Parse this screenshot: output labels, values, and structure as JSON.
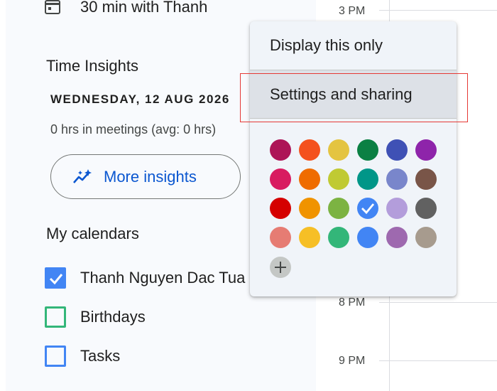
{
  "event": {
    "title": "30 min with Thanh"
  },
  "time_insights": {
    "heading": "Time Insights",
    "date": "WEDNESDAY, 12 AUG 2026",
    "meetings_summary": "0 hrs in meetings (avg: 0 hrs)",
    "more_button_label": "More insights"
  },
  "my_calendars": {
    "heading": "My calendars",
    "items": [
      {
        "label": "Thanh Nguyen Dac Tua",
        "checked": true,
        "color": "#4285f4"
      },
      {
        "label": "Birthdays",
        "checked": false,
        "color": "#33b679"
      },
      {
        "label": "Tasks",
        "checked": false,
        "color": "#4285f4"
      }
    ]
  },
  "time_grid": {
    "labels": [
      "3 PM",
      "8 PM",
      "9 PM"
    ]
  },
  "context_menu": {
    "items": [
      {
        "label": "Display this only"
      },
      {
        "label": "Settings and sharing",
        "highlighted": true
      }
    ],
    "selected_color": "#4285f4",
    "colors": [
      "#ad1457",
      "#f4511e",
      "#e4c441",
      "#0b8043",
      "#3f51b5",
      "#8e24aa",
      "#d81b60",
      "#ef6c00",
      "#c0ca33",
      "#009688",
      "#7986cb",
      "#795548",
      "#d50000",
      "#f09300",
      "#7cb342",
      "#4285f4",
      "#b39ddb",
      "#616161",
      "#e67c73",
      "#f6bf26",
      "#33b679",
      "#4285f4",
      "#9e69af",
      "#a79b8e"
    ],
    "add_color_label": "+"
  }
}
